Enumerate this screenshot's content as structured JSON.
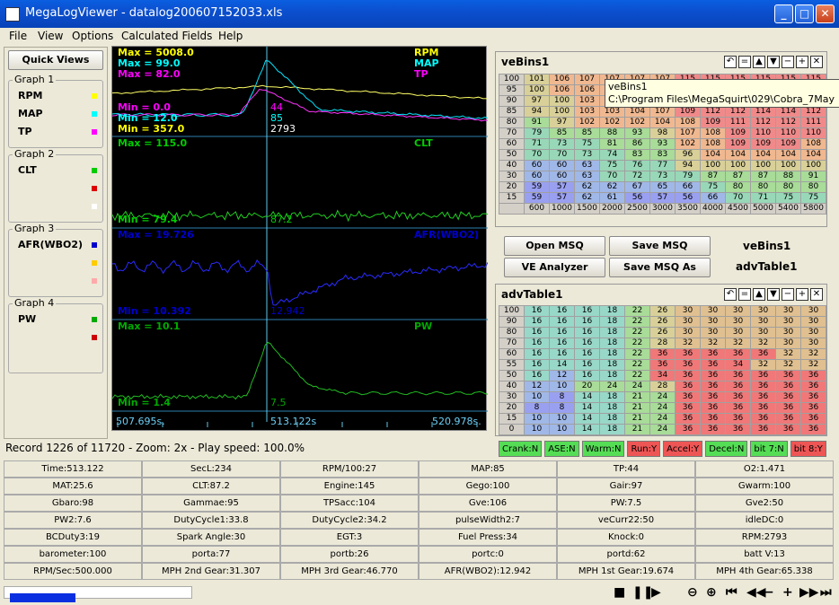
{
  "window": {
    "title": "MegaLogViewer - datalog200607152033.xls"
  },
  "menu": [
    "File",
    "View",
    "Options",
    "Calculated Fields",
    "Help"
  ],
  "left": {
    "quick_views": "Quick Views",
    "graphs": [
      {
        "title": "Graph 1",
        "items": [
          {
            "label": "RPM",
            "color": "#ffff00"
          },
          {
            "label": "MAP",
            "color": "#00ffff"
          },
          {
            "label": "TP",
            "color": "#ff00ff"
          }
        ]
      },
      {
        "title": "Graph 2",
        "items": [
          {
            "label": "CLT",
            "color": "#00cc00"
          },
          {
            "label": "",
            "color": "#dd0000"
          },
          {
            "label": "",
            "color": "#ffffff"
          }
        ]
      },
      {
        "title": "Graph 3",
        "items": [
          {
            "label": "AFR(WBO2)",
            "color": "#0000cc"
          },
          {
            "label": "",
            "color": "#ffcc00"
          },
          {
            "label": "",
            "color": "#ffaaaa"
          }
        ]
      },
      {
        "title": "Graph 4",
        "items": [
          {
            "label": "PW",
            "color": "#00aa00"
          },
          {
            "label": "",
            "color": "#cc0000"
          }
        ]
      }
    ]
  },
  "chart": {
    "g1": {
      "max_rpm": "Max = 5008.0",
      "max_map": "Max = 99.0",
      "max_tp": "Max = 82.0",
      "min_rpm": "Min = 357.0",
      "min_map": "Min = 12.0",
      "min_tp": "Min = 0.0",
      "lbl_rpm": "RPM",
      "lbl_map": "MAP",
      "lbl_tp": "TP",
      "cur_tp": "44",
      "cur_map": "85",
      "cur_rpm": "2793"
    },
    "g2": {
      "max": "Max = 115.0",
      "min": "Min = 79.4",
      "lbl": "CLT",
      "cur": "87.2"
    },
    "g3": {
      "max": "Max = 19.726",
      "min": "Min = 10.392",
      "lbl": "AFR(WBO2)",
      "cur": "12.942"
    },
    "g4": {
      "max": "Max = 10.1",
      "min": "Min = 1.4",
      "lbl": "PW",
      "cur": "7.5"
    },
    "time_left": "507.695s.",
    "time_mid": "513.122s",
    "time_right": "520.978s."
  },
  "record_text": "Record 1226 of 11720 - Zoom: 2x - Play speed: 100.0%",
  "ve": {
    "title": "veBins1",
    "rows": [
      "100",
      "95",
      "90",
      "85",
      "80",
      "70",
      "60",
      "50",
      "40",
      "30",
      "20",
      "15"
    ],
    "cols": [
      "600",
      "1000",
      "1500",
      "2000",
      "2500",
      "3000",
      "3500",
      "4000",
      "4500",
      "5000",
      "5400",
      "5800"
    ],
    "cells": [
      [
        "101",
        "106",
        "107",
        "107",
        "107",
        "107",
        "115",
        "115",
        "115",
        "115",
        "115",
        "115"
      ],
      [
        "100",
        "106",
        "106",
        "106",
        "106",
        "106",
        "106",
        "106",
        "106",
        "106",
        "106",
        "106"
      ],
      [
        "97",
        "100",
        "103",
        "104",
        "104",
        "104",
        "104",
        "104",
        "104",
        "104",
        "104",
        "104"
      ],
      [
        "94",
        "100",
        "103",
        "103",
        "104",
        "107",
        "109",
        "112",
        "112",
        "114",
        "114",
        "112"
      ],
      [
        "91",
        "97",
        "102",
        "102",
        "102",
        "104",
        "108",
        "109",
        "111",
        "112",
        "112",
        "111"
      ],
      [
        "79",
        "85",
        "85",
        "88",
        "93",
        "98",
        "107",
        "108",
        "109",
        "110",
        "110",
        "110"
      ],
      [
        "71",
        "73",
        "75",
        "81",
        "86",
        "93",
        "102",
        "108",
        "109",
        "109",
        "109",
        "108"
      ],
      [
        "70",
        "70",
        "73",
        "74",
        "83",
        "83",
        "96",
        "104",
        "104",
        "104",
        "104",
        "104"
      ],
      [
        "60",
        "60",
        "63",
        "75",
        "76",
        "77",
        "94",
        "100",
        "100",
        "100",
        "100",
        "100"
      ],
      [
        "60",
        "60",
        "63",
        "70",
        "72",
        "73",
        "79",
        "87",
        "87",
        "87",
        "88",
        "91"
      ],
      [
        "59",
        "57",
        "62",
        "62",
        "67",
        "65",
        "66",
        "75",
        "80",
        "80",
        "80",
        "80"
      ],
      [
        "59",
        "57",
        "62",
        "61",
        "56",
        "57",
        "56",
        "66",
        "70",
        "71",
        "75",
        "75"
      ]
    ]
  },
  "tooltip": {
    "line1": "veBins1",
    "line2": "C:\\Program Files\\MegaSquirt\\029\\Cobra_7May"
  },
  "buttons": {
    "open": "Open MSQ",
    "save": "Save MSQ",
    "ve": "VE Analyzer",
    "saveas": "Save MSQ As",
    "lbl1": "veBins1",
    "lbl2": "advTable1"
  },
  "adv": {
    "title": "advTable1",
    "rows": [
      "100",
      "90",
      "80",
      "70",
      "60",
      "55",
      "50",
      "40",
      "30",
      "20",
      "15",
      "0"
    ],
    "cells": [
      [
        "16",
        "16",
        "16",
        "18",
        "22",
        "26",
        "30",
        "30",
        "30",
        "30",
        "30",
        "30"
      ],
      [
        "16",
        "16",
        "16",
        "18",
        "22",
        "26",
        "30",
        "30",
        "30",
        "30",
        "30",
        "30"
      ],
      [
        "16",
        "16",
        "16",
        "18",
        "22",
        "26",
        "30",
        "30",
        "30",
        "30",
        "30",
        "30"
      ],
      [
        "16",
        "16",
        "16",
        "18",
        "22",
        "28",
        "32",
        "32",
        "32",
        "32",
        "30",
        "30"
      ],
      [
        "16",
        "16",
        "16",
        "18",
        "22",
        "36",
        "36",
        "36",
        "36",
        "36",
        "32",
        "32"
      ],
      [
        "16",
        "14",
        "16",
        "18",
        "22",
        "36",
        "36",
        "36",
        "34",
        "32",
        "32",
        "32"
      ],
      [
        "16",
        "12",
        "16",
        "18",
        "22",
        "34",
        "36",
        "36",
        "36",
        "36",
        "36",
        "36"
      ],
      [
        "12",
        "10",
        "20",
        "24",
        "24",
        "28",
        "36",
        "36",
        "36",
        "36",
        "36",
        "36"
      ],
      [
        "10",
        "8",
        "14",
        "18",
        "21",
        "24",
        "36",
        "36",
        "36",
        "36",
        "36",
        "36"
      ],
      [
        "8",
        "8",
        "14",
        "18",
        "21",
        "24",
        "36",
        "36",
        "36",
        "36",
        "36",
        "36"
      ],
      [
        "10",
        "10",
        "14",
        "18",
        "21",
        "24",
        "36",
        "36",
        "36",
        "36",
        "36",
        "36"
      ],
      [
        "10",
        "10",
        "14",
        "18",
        "21",
        "24",
        "36",
        "36",
        "36",
        "36",
        "36",
        "36"
      ]
    ]
  },
  "flags": [
    {
      "text": "Crank:N",
      "color": "#55dd55"
    },
    {
      "text": "ASE:N",
      "color": "#55dd55"
    },
    {
      "text": "Warm:N",
      "color": "#55dd55"
    },
    {
      "text": "Run:Y",
      "color": "#ee5555"
    },
    {
      "text": "Accel:Y",
      "color": "#ee5555"
    },
    {
      "text": "Decel:N",
      "color": "#55dd55"
    },
    {
      "text": "bit 7:N",
      "color": "#55dd55"
    },
    {
      "text": "bit 8:Y",
      "color": "#ee5555"
    }
  ],
  "readouts": [
    [
      "Time:513.122",
      "SecL:234",
      "RPM/100:27",
      "MAP:85",
      "TP:44",
      "O2:1.471"
    ],
    [
      "MAT:25.6",
      "CLT:87.2",
      "Engine:145",
      "Gego:100",
      "Gair:97",
      "Gwarm:100"
    ],
    [
      "Gbaro:98",
      "Gammae:95",
      "TPSacc:104",
      "Gve:106",
      "PW:7.5",
      "Gve2:50"
    ],
    [
      "PW2:7.6",
      "DutyCycle1:33.8",
      "DutyCycle2:34.2",
      "pulseWidth2:7",
      "veCurr22:50",
      "idleDC:0"
    ],
    [
      "BCDuty3:19",
      "Spark Angle:30",
      "EGT:3",
      "Fuel Press:34",
      "Knock:0",
      "RPM:2793"
    ],
    [
      "barometer:100",
      "porta:77",
      "portb:26",
      "portc:0",
      "portd:62",
      "batt V:13"
    ],
    [
      "RPM/Sec:500.000",
      "MPH 2nd Gear:31.307",
      "MPH 3rd Gear:46.770",
      "AFR(WBO2):12.942",
      "MPH 1st Gear:19.674",
      "MPH 4th Gear:65.338"
    ]
  ]
}
